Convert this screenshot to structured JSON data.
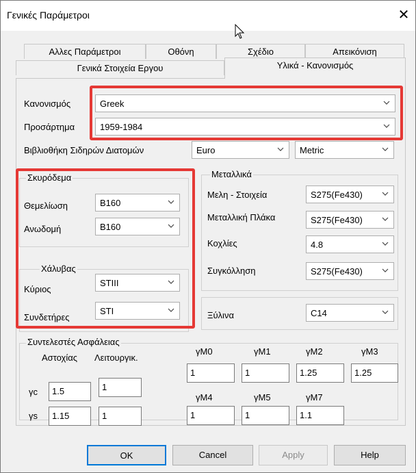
{
  "window": {
    "title": "Γενικές Παράμετροι"
  },
  "tabs": {
    "row1": [
      "Αλλες Παράμετροι",
      "Οθόνη",
      "Σχέδιο",
      "Απεικόνιση"
    ],
    "row2": [
      "Γενικά Στοιχεία Εργου",
      "Υλικά - Κανονισμός"
    ]
  },
  "code": {
    "label": "Κανονισμός",
    "value": "Greek",
    "annex_label": "Προσάρτημα",
    "annex_value": "1959-1984",
    "library_label": "Βιβλιοθήκη Σιδηρών Διατομών",
    "library_value": "Euro",
    "units_value": "Metric"
  },
  "concrete": {
    "group_label": "Σκυρόδεμα",
    "foundation_label": "Θεμελίωση",
    "foundation_value": "B160",
    "super_label": "Ανωδομή",
    "super_value": "B160"
  },
  "steel": {
    "group_label": "Χάλυβας",
    "main_label": "Κύριος",
    "main_value": "STIII",
    "stirrups_label": "Συνδετήρες",
    "stirrups_value": "STI"
  },
  "metal": {
    "group_label": "Μεταλλικά",
    "members_label": "Μελη - Στοιχεία",
    "members_value": "S275(Fe430)",
    "plate_label": "Μεταλλική Πλάκα",
    "plate_value": "S275(Fe430)",
    "bolts_label": "Κοχλίες",
    "bolts_value": "4.8",
    "weld_label": "Συγκόλληση",
    "weld_value": "S275(Fe430)"
  },
  "timber": {
    "label": "Ξύλινα",
    "value": "C14"
  },
  "safety": {
    "group_label": "Συντελεστές Ασφάλειας",
    "col_failure": "Αστοχίας",
    "col_service": "Λειτουργικ.",
    "gc_label": "γc",
    "gc_failure": "1.5",
    "gc_service": "1",
    "gs_label": "γs",
    "gs_failure": "1.15",
    "gs_service": "1",
    "gm0_label": "γM0",
    "gm0": "1",
    "gm1_label": "γM1",
    "gm1": "1",
    "gm2_label": "γM2",
    "gm2": "1.25",
    "gm3_label": "γM3",
    "gm3": "1.25",
    "gm4_label": "γM4",
    "gm4": "1",
    "gm5_label": "γM5",
    "gm5": "1",
    "gm7_label": "γM7",
    "gm7": "1.1"
  },
  "buttons": {
    "ok": "OK",
    "cancel": "Cancel",
    "apply": "Apply",
    "help": "Help"
  },
  "colors": {
    "highlight": "#e53935",
    "window_bg": "#f0f0f0"
  }
}
